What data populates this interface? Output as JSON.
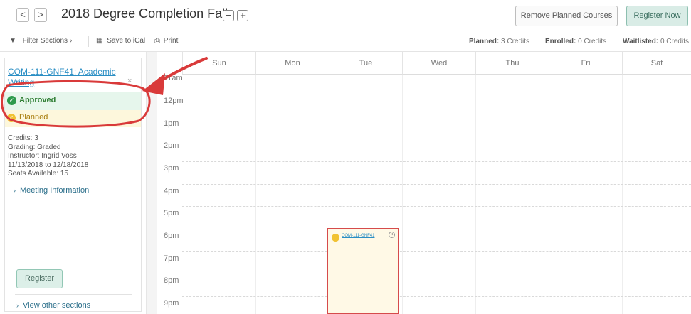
{
  "header": {
    "prev_label": "<",
    "next_label": ">",
    "title": "2018 Degree Completion Fall",
    "zoom_out_label": "−",
    "zoom_in_label": "+",
    "remove_planned_label": "Remove Planned Courses",
    "register_now_label": "Register Now"
  },
  "toolbar": {
    "filter_label": "Filter Sections ›",
    "save_ical_label": "Save to iCal",
    "print_label": "Print",
    "planned_label": "Planned:",
    "planned_value": "3 Credits",
    "enrolled_label": "Enrolled:",
    "enrolled_value": "0 Credits",
    "waitlisted_label": "Waitlisted:",
    "waitlisted_value": "0 Credits"
  },
  "course_card": {
    "title": "COM-111-GNF41: Academic Writing",
    "close_label": "×",
    "status_approved": "Approved",
    "status_planned": "Planned",
    "credits": "Credits: 3",
    "grading": "Grading: Graded",
    "instructor": "Instructor: Ingrid Voss",
    "dates": "11/13/2018 to 12/18/2018",
    "seats": "Seats Available: 15",
    "meeting_info": "Meeting Information",
    "register_label": "Register",
    "view_other": "View other sections"
  },
  "calendar": {
    "days": [
      "Sun",
      "Mon",
      "Tue",
      "Wed",
      "Thu",
      "Fri",
      "Sat"
    ],
    "times": [
      "11am",
      "12pm",
      "1pm",
      "2pm",
      "3pm",
      "4pm",
      "5pm",
      "6pm",
      "7pm",
      "8pm",
      "9pm"
    ],
    "event_label": "COM-111-GNF41"
  },
  "colors": {
    "accent_link": "#2a8ec4",
    "approved_green": "#2e9a4d",
    "planned_yellow": "#f1c232",
    "annotation_red": "#d93a3a"
  }
}
